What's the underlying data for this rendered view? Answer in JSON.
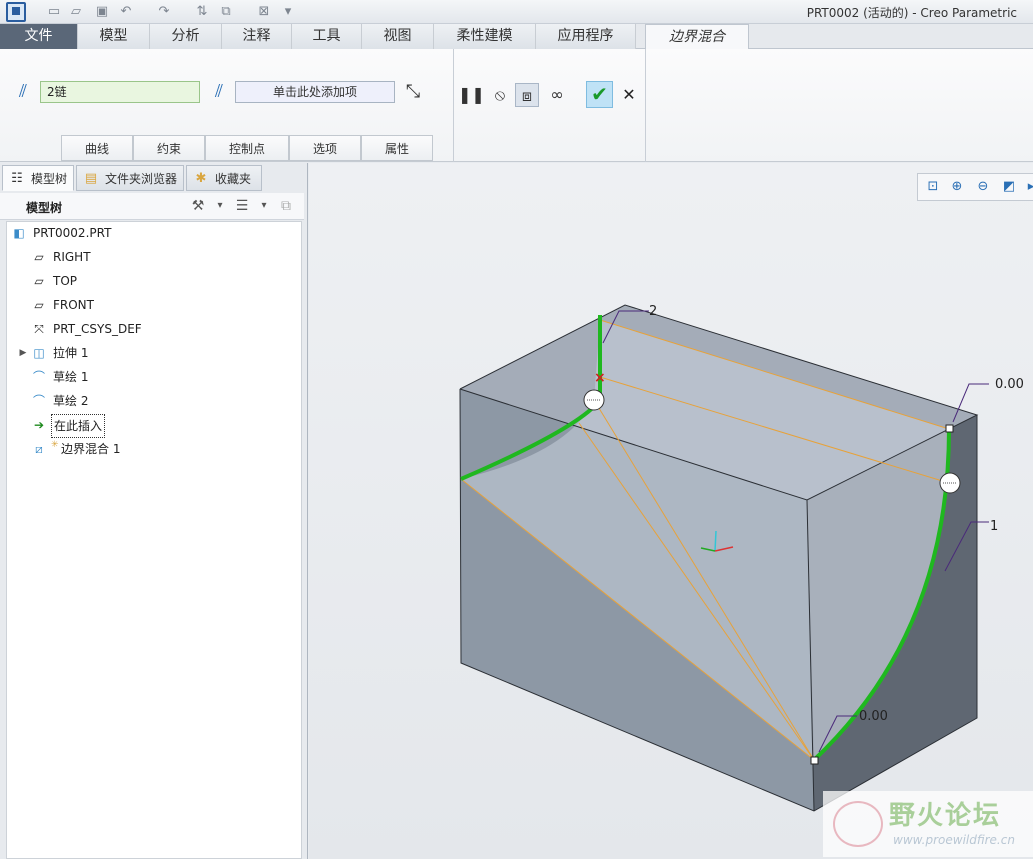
{
  "window": {
    "title": "PRT0002 (活动的) - Creo Parametric"
  },
  "quick_access": {
    "icons": [
      "new-icon",
      "open-icon",
      "save-icon",
      "undo-icon",
      "redo-icon",
      "regenerate-icon",
      "window-icon",
      "close-window-icon",
      "customize-icon"
    ]
  },
  "tabs": [
    {
      "label": "文件"
    },
    {
      "label": "模型"
    },
    {
      "label": "分析"
    },
    {
      "label": "注释"
    },
    {
      "label": "工具"
    },
    {
      "label": "视图"
    },
    {
      "label": "柔性建模"
    },
    {
      "label": "应用程序"
    },
    {
      "label": "边界混合"
    }
  ],
  "ribbon": {
    "first_direction_value": "2链",
    "second_direction_placeholder": "单击此处添加项",
    "subtabs": [
      "曲线",
      "约束",
      "控制点",
      "选项",
      "属性"
    ]
  },
  "panel": {
    "tabs": [
      "模型树",
      "文件夹浏览器",
      "收藏夹"
    ],
    "tree_title": "模型树"
  },
  "tree": [
    {
      "label": "PRT0002.PRT",
      "icon": "part-icon"
    },
    {
      "label": "RIGHT",
      "icon": "datum-plane-icon"
    },
    {
      "label": "TOP",
      "icon": "datum-plane-icon"
    },
    {
      "label": "FRONT",
      "icon": "datum-plane-icon"
    },
    {
      "label": "PRT_CSYS_DEF",
      "icon": "csys-icon"
    },
    {
      "label": "拉伸 1",
      "icon": "extrude-icon"
    },
    {
      "label": "草绘 1",
      "icon": "sketch-icon"
    },
    {
      "label": "草绘 2",
      "icon": "sketch-icon"
    },
    {
      "label": "在此插入",
      "icon": "insert-arrow-icon"
    },
    {
      "label": "边界混合 1",
      "icon": "boundary-blend-icon"
    }
  ],
  "viewport": {
    "annotations": {
      "chain2": "2",
      "chain1": "1",
      "val_top_right": "0.00",
      "val_bottom": "0.00"
    }
  },
  "watermark": {
    "text": "野火论坛",
    "url": "www.proewildfire.cn"
  },
  "colors": {
    "accent": "#2a6fb5",
    "curve": "#1fb81f",
    "body": "#8c96a2",
    "file_tab": "#5a6778"
  }
}
